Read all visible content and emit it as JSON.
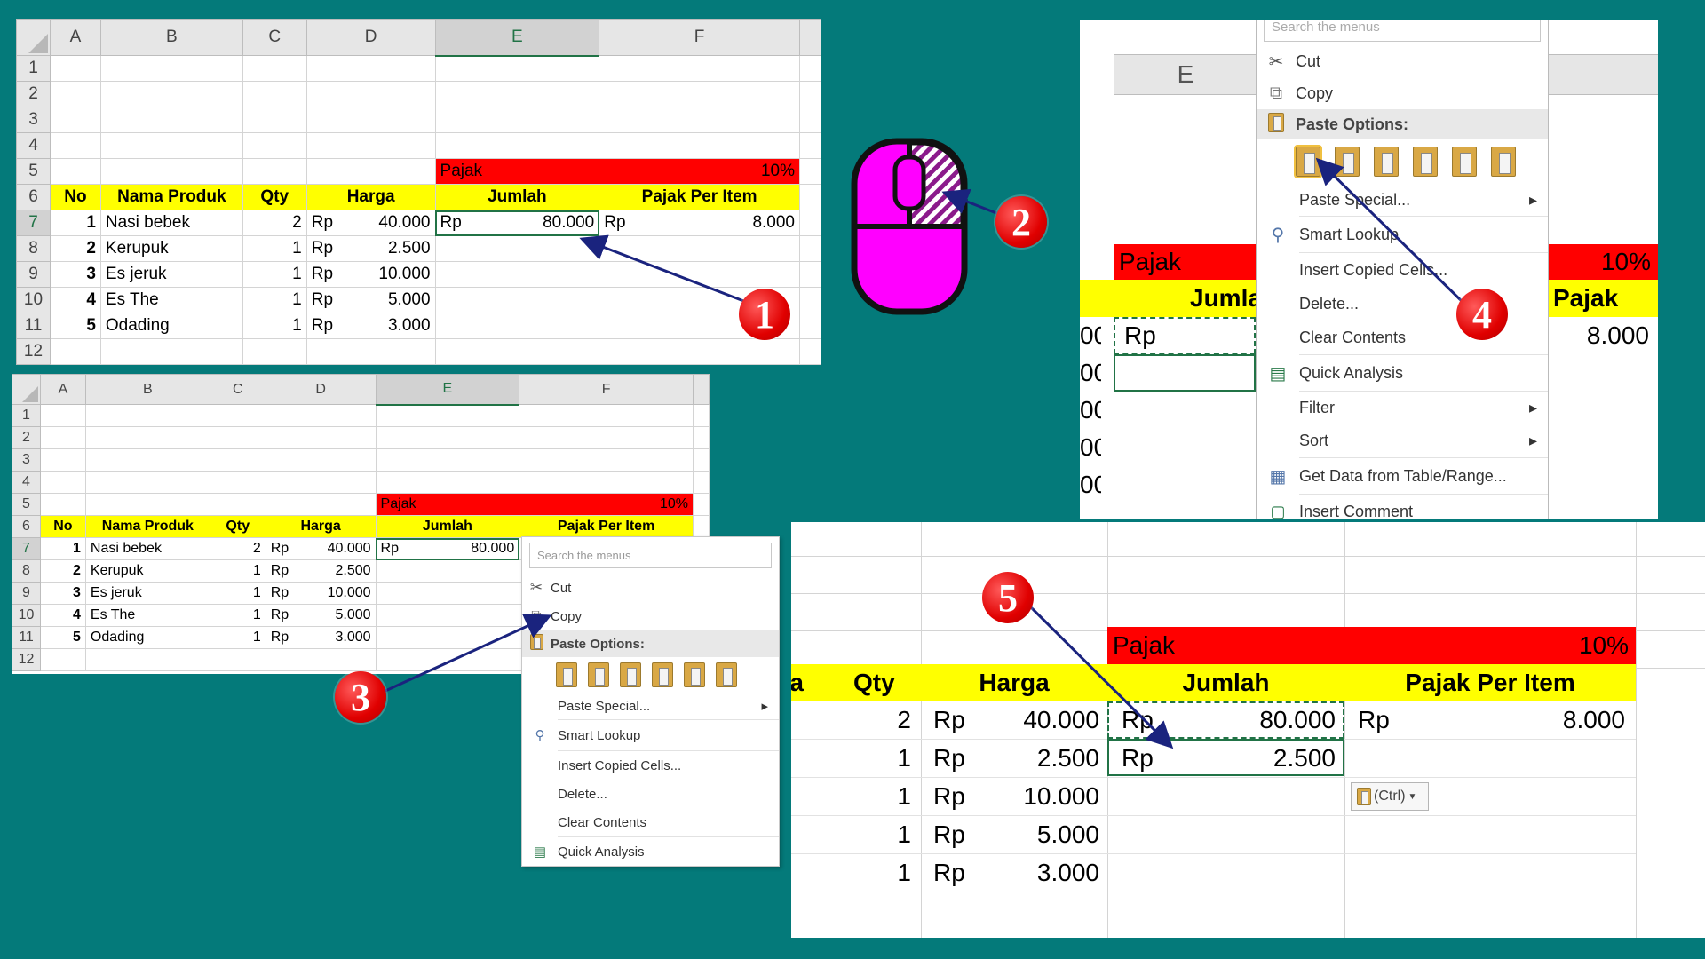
{
  "cols": {
    "corner": "",
    "a": "A",
    "b": "B",
    "c": "C",
    "d": "D",
    "e": "E",
    "f": "F"
  },
  "rows": [
    "1",
    "2",
    "3",
    "4",
    "5",
    "6",
    "7",
    "8",
    "9",
    "10",
    "11",
    "12"
  ],
  "sheet": {
    "pajak_label": "Pajak",
    "pajak_rate": "10%",
    "headers": {
      "no": "No",
      "nama": "Nama Produk",
      "qty": "Qty",
      "harga": "Harga",
      "jumlah": "Jumlah",
      "pajak_item": "Pajak Per Item"
    },
    "currency": "Rp",
    "items": [
      {
        "no": "1",
        "nama": "Nasi bebek",
        "qty": "2",
        "harga": "40.000"
      },
      {
        "no": "2",
        "nama": "Kerupuk",
        "qty": "1",
        "harga": "2.500"
      },
      {
        "no": "3",
        "nama": "Es jeruk",
        "qty": "1",
        "harga": "10.000"
      },
      {
        "no": "4",
        "nama": "Es The",
        "qty": "1",
        "harga": "5.000"
      },
      {
        "no": "5",
        "nama": "Odading",
        "qty": "1",
        "harga": "3.000"
      }
    ],
    "jumlah_row7": "80.000",
    "jumlah_row8": "2.500",
    "pajak_row7": "8.000"
  },
  "menu": {
    "search_placeholder": "Search the menus",
    "cut": "Cut",
    "copy": "Copy",
    "paste_options": "Paste Options:",
    "paste_special": "Paste Special...",
    "smart_lookup": "Smart Lookup",
    "insert_copied": "Insert Copied Cells...",
    "delete": "Delete...",
    "clear_contents": "Clear Contents",
    "quick_analysis": "Quick Analysis",
    "filter": "Filter",
    "sort": "Sort",
    "get_data": "Get Data from Table/Range...",
    "insert_comment": "Insert Comment"
  },
  "paste_ctrl": "(Ctrl)",
  "steps": [
    "1",
    "2",
    "3",
    "4",
    "5"
  ],
  "colors": {
    "background": "#047a7a",
    "badge": "#e00000",
    "arrow": "#1a237e",
    "mouse": "#ff00ff",
    "header_fill": "#ffff00",
    "pajak_fill": "#ff0000",
    "excel_green": "#217346"
  }
}
